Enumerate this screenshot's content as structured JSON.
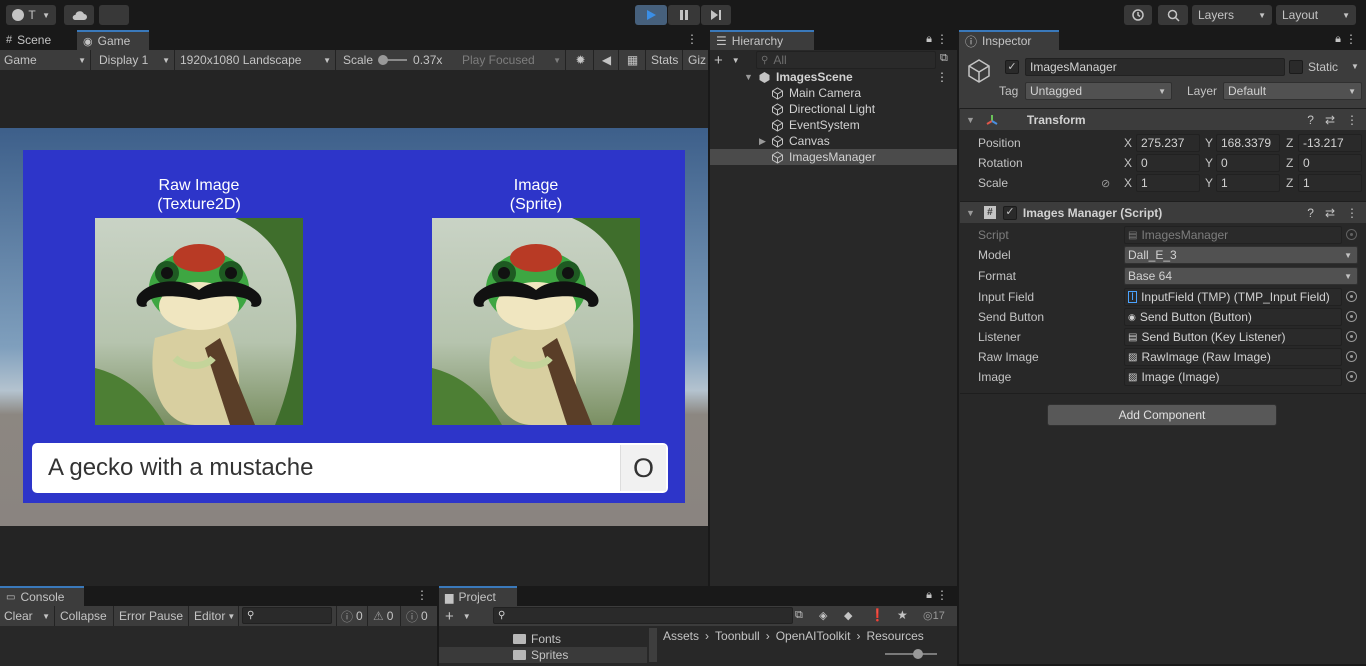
{
  "toolbar": {
    "account_label": "T",
    "layers_label": "Layers",
    "layout_label": "Layout"
  },
  "game_view": {
    "tabs": [
      "Scene",
      "Game"
    ],
    "game_dropdown": "Game",
    "display_dropdown": "Display 1",
    "resolution_dropdown": "1920x1080 Landscape",
    "scale_label": "Scale",
    "scale_value": "0.37x",
    "play_focused": "Play Focused",
    "stats_label": "Stats",
    "gizmos_label": "Giz",
    "raw_image_title": "Raw Image",
    "raw_image_subtitle": "(Texture2D)",
    "image_title": "Image",
    "image_subtitle": "(Sprite)",
    "input_text": "A gecko with a mustache",
    "send_label": "O",
    "scene_bg": "#2d35c9"
  },
  "hierarchy": {
    "tab": "Hierarchy",
    "search_placeholder": "All",
    "scene_name": "ImagesScene",
    "items": [
      "Main Camera",
      "Directional Light",
      "EventSystem",
      "Canvas",
      "ImagesManager"
    ]
  },
  "inspector": {
    "tab": "Inspector",
    "object_name": "ImagesManager",
    "static_label": "Static",
    "tag_label": "Tag",
    "tag_value": "Untagged",
    "layer_label": "Layer",
    "layer_value": "Default",
    "transform": {
      "title": "Transform",
      "position_label": "Position",
      "rotation_label": "Rotation",
      "scale_label": "Scale",
      "position": {
        "x": "275.237",
        "y": "168.3379",
        "z": "-13.217"
      },
      "rotation": {
        "x": "0",
        "y": "0",
        "z": "0"
      },
      "scale": {
        "x": "1",
        "y": "1",
        "z": "1"
      }
    },
    "script_component": {
      "title": "Images Manager (Script)",
      "fields": [
        {
          "label": "Script",
          "value": "ImagesManager"
        },
        {
          "label": "Model",
          "value": "Dall_E_3"
        },
        {
          "label": "Format",
          "value": "Base 64"
        },
        {
          "label": "Input Field",
          "value": "InputField (TMP) (TMP_Input Field)"
        },
        {
          "label": "Send Button",
          "value": "Send Button (Button)"
        },
        {
          "label": "Listener",
          "value": "Send Button (Key Listener)"
        },
        {
          "label": "Raw Image",
          "value": "RawImage (Raw Image)"
        },
        {
          "label": "Image",
          "value": "Image (Image)"
        }
      ]
    },
    "add_component": "Add Component"
  },
  "console": {
    "tab": "Console",
    "clear": "Clear",
    "collapse": "Collapse",
    "error_pause": "Error Pause",
    "editor": "Editor",
    "log_count": "0",
    "warn_count": "0",
    "error_count": "0"
  },
  "project": {
    "tab": "Project",
    "hidden_count": "17",
    "folders": [
      "Fonts",
      "Sprites"
    ],
    "breadcrumb": [
      "Assets",
      "Toonbull",
      "OpenAIToolkit",
      "Resources"
    ]
  }
}
